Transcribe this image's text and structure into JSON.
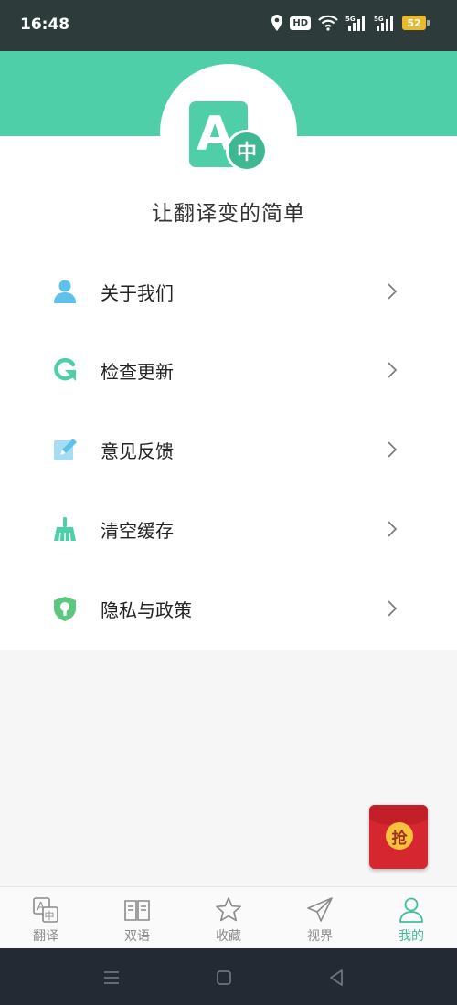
{
  "status_bar": {
    "time": "16:48",
    "hd_label": "HD",
    "battery": "52",
    "icons": [
      "location-icon",
      "hd-icon",
      "wifi-icon",
      "signal-5g-icon",
      "signal-5g-icon",
      "battery-icon"
    ]
  },
  "header": {
    "logo_letter": "A",
    "logo_badge": "中",
    "slogan": "让翻译变的简单"
  },
  "menu": [
    {
      "label": "关于我们",
      "icon": "user-icon"
    },
    {
      "label": "检查更新",
      "icon": "refresh-icon"
    },
    {
      "label": "意见反馈",
      "icon": "edit-icon"
    },
    {
      "label": "清空缓存",
      "icon": "broom-icon"
    },
    {
      "label": "隐私与政策",
      "icon": "shield-icon"
    }
  ],
  "red_packet": {
    "label": "抢"
  },
  "bottom_nav": [
    {
      "label": "翻译",
      "icon": "translate-icon",
      "active": false
    },
    {
      "label": "双语",
      "icon": "book-icon",
      "active": false
    },
    {
      "label": "收藏",
      "icon": "star-icon",
      "active": false
    },
    {
      "label": "视界",
      "icon": "paper-plane-icon",
      "active": false
    },
    {
      "label": "我的",
      "icon": "profile-icon",
      "active": true
    }
  ],
  "colors": {
    "accent": "#4ecfa8",
    "status_bar": "#2d3b3b",
    "system_nav": "#232a33",
    "red_packet": "#d6262f"
  }
}
